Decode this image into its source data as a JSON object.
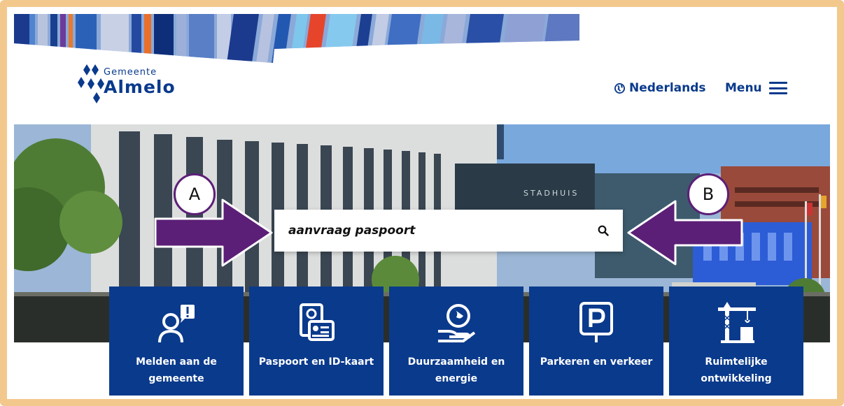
{
  "logo": {
    "small": "Gemeente",
    "big": "Almelo"
  },
  "nav": {
    "language": "Nederlands",
    "menu": "Menu"
  },
  "search": {
    "value": "aanvraag paspoort",
    "placeholder": ""
  },
  "callouts": [
    "A",
    "B"
  ],
  "hero_sign": "STADHUIS",
  "tiles": [
    {
      "label": "Melden aan de gemeente",
      "icon": "person-alert-icon"
    },
    {
      "label": "Paspoort en ID-kaart",
      "icon": "passport-id-icon"
    },
    {
      "label": "Duurzaamheid en energie",
      "icon": "hand-globe-icon"
    },
    {
      "label": "Parkeren en verkeer",
      "icon": "parking-icon"
    },
    {
      "label": "Ruimtelijke ontwikkeling",
      "icon": "crane-icon"
    }
  ],
  "colors": {
    "brand": "#0a3a8c",
    "arrow": "#5c1f77",
    "frame": "#f2c88d"
  }
}
